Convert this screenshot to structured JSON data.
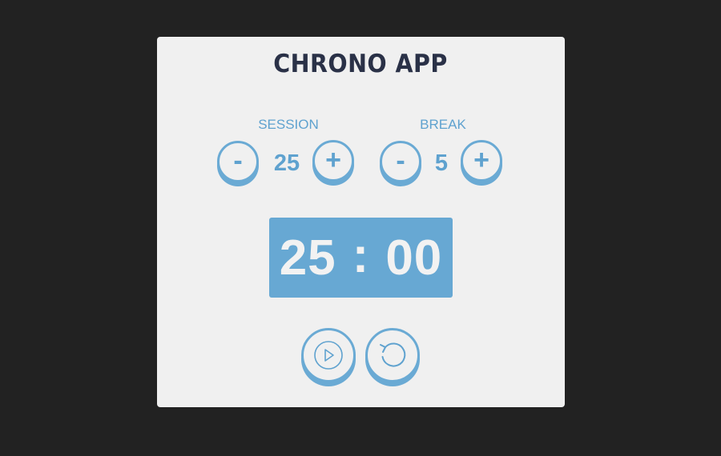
{
  "app": {
    "title": "CHRONO APP"
  },
  "session": {
    "label": "SESSION",
    "value": "25",
    "decrement_label": "-",
    "increment_label": "+"
  },
  "break": {
    "label": "BREAK",
    "value": "5",
    "decrement_label": "-",
    "increment_label": "+"
  },
  "timer": {
    "minutes": "25",
    "separator": ":",
    "seconds": "00"
  },
  "controls": {
    "play_icon": "play-icon",
    "reset_icon": "reset-icon"
  },
  "colors": {
    "background": "#222222",
    "card": "#f0f0f0",
    "accent": "#67a8d3",
    "title": "#2a3147",
    "display_text": "#f2f2f2"
  }
}
